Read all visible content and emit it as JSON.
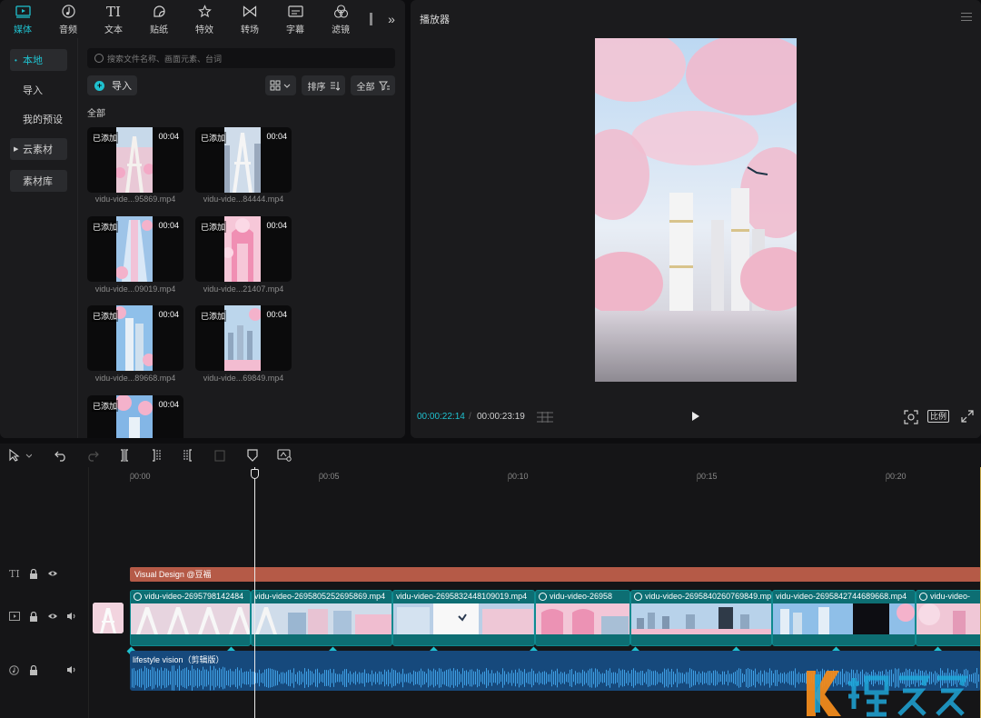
{
  "tabs": [
    {
      "label": "媒体",
      "icon": "media-icon"
    },
    {
      "label": "音频",
      "icon": "audio-icon"
    },
    {
      "label": "文本",
      "icon": "text-icon"
    },
    {
      "label": "贴纸",
      "icon": "sticker-icon"
    },
    {
      "label": "特效",
      "icon": "effects-icon"
    },
    {
      "label": "转场",
      "icon": "transition-icon"
    },
    {
      "label": "字幕",
      "icon": "subtitle-icon"
    },
    {
      "label": "滤镜",
      "icon": "filter-icon"
    }
  ],
  "sidebar": {
    "items": [
      {
        "label": "本地"
      },
      {
        "label": "导入"
      },
      {
        "label": "我的预设"
      },
      {
        "label": "云素材"
      },
      {
        "label": "素材库"
      }
    ]
  },
  "media": {
    "search_placeholder": "搜索文件名称、画面元素、台词",
    "import_label": "导入",
    "sort_label": "排序",
    "filter_label": "全部",
    "section_label": "全部",
    "added_label": "已添加",
    "clips": [
      {
        "name": "vidu-vide...95869.mp4",
        "duration": "00:04"
      },
      {
        "name": "vidu-vide...84444.mp4",
        "duration": "00:04"
      },
      {
        "name": "vidu-vide...09019.mp4",
        "duration": "00:04"
      },
      {
        "name": "vidu-vide...21407.mp4",
        "duration": "00:04"
      },
      {
        "name": "vidu-vide...89668.mp4",
        "duration": "00:04"
      },
      {
        "name": "vidu-vide...69849.mp4",
        "duration": "00:04"
      },
      {
        "name": "",
        "duration": "00:04"
      }
    ]
  },
  "player": {
    "title": "播放器",
    "current_time": "00:00:22:14",
    "total_time": "00:00:23:19",
    "ratio_label": "比例"
  },
  "timeline": {
    "ruler": [
      "00:00",
      "00:05",
      "00:10",
      "00:15",
      "00:20"
    ],
    "text_clip": "Visual Design @豆福",
    "video_clips": [
      {
        "name": "vidu-video-2695798142484"
      },
      {
        "name": "vidu-video-2695805252695869.mp4"
      },
      {
        "name": "vidu-video-2695832448109019.mp4"
      },
      {
        "name": "vidu-video-26958"
      },
      {
        "name": "vidu-video-2695840260769849.mp4"
      },
      {
        "name": "vidu-video-2695842744689668.mp4"
      },
      {
        "name": "vidu-video-"
      }
    ],
    "audio_clip": "lifestyle vision（剪辑版）"
  },
  "colors": {
    "accent": "#1fc1cf",
    "text_clip": "#b55a47",
    "video_clip": "#0d6e73",
    "audio_clip": "#16497c"
  }
}
